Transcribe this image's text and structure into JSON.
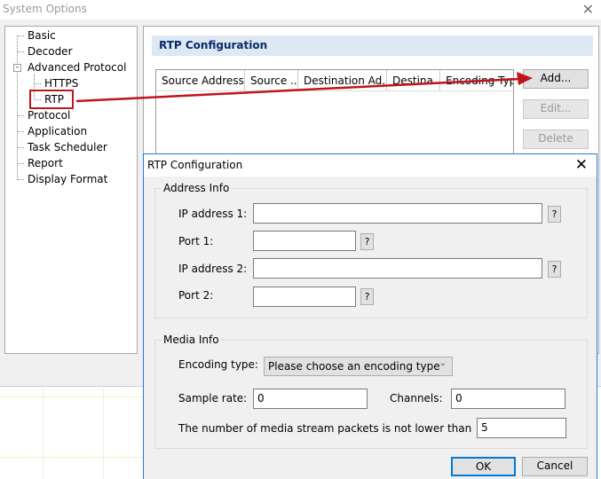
{
  "main_window": {
    "title": "System Options",
    "close_icon": "close-icon"
  },
  "tree": {
    "items": [
      {
        "label": "Basic",
        "level": 0
      },
      {
        "label": "Decoder",
        "level": 0
      },
      {
        "label": "Advanced Protocol",
        "level": 0,
        "expanded": true
      },
      {
        "label": "HTTPS",
        "level": 1
      },
      {
        "label": "RTP",
        "level": 1,
        "highlighted": true
      },
      {
        "label": "Protocol",
        "level": 0
      },
      {
        "label": "Application",
        "level": 0
      },
      {
        "label": "Task Scheduler",
        "level": 0
      },
      {
        "label": "Report",
        "level": 0
      },
      {
        "label": "Display Format",
        "level": 0
      }
    ]
  },
  "panel": {
    "header": "RTP Configuration",
    "columns": [
      "Source Address",
      "Source ...",
      "Destination Ad...",
      "Destina...",
      "Encoding Typ"
    ],
    "buttons": {
      "add": "Add...",
      "edit": "Edit...",
      "delete": "Delete"
    }
  },
  "annotation": {
    "color": "#c0141c"
  },
  "dialog": {
    "title": "RTP Configuration",
    "address_group": "Address Info",
    "ip1_label": "IP address 1:",
    "port1_label": "Port 1:",
    "ip2_label": "IP address 2:",
    "port2_label": "Port 2:",
    "ip1": "",
    "port1": "",
    "ip2": "",
    "port2": "",
    "help": "?",
    "media_group": "Media Info",
    "encoding_label": "Encoding type:",
    "encoding_value": "Please choose an encoding type",
    "sample_rate_label": "Sample rate:",
    "sample_rate": "0",
    "channels_label": "Channels:",
    "channels": "0",
    "packets_label": "The number of media stream packets is not lower than",
    "packets": "5",
    "ok": "OK",
    "cancel": "Cancel"
  }
}
